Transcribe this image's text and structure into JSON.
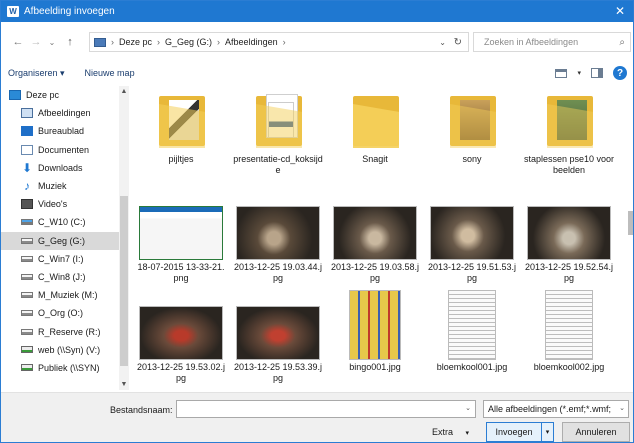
{
  "window": {
    "title": "Afbeelding invoegen",
    "app_icon": "word-icon",
    "close_glyph": "✕"
  },
  "nav_buttons": {
    "back": "←",
    "forward": "→",
    "recent": "⌄",
    "up": "↑"
  },
  "address": {
    "crumbs": [
      "Deze pc",
      "G_Geg (G:)",
      "Afbeeldingen"
    ],
    "separator": "›",
    "dropdown": "⌄",
    "refresh": "↻"
  },
  "search": {
    "placeholder": "Zoeken in Afbeeldingen",
    "icon": "⌕"
  },
  "toolbar": {
    "organize": "Organiseren ▾",
    "new_folder": "Nieuwe map",
    "dd": "▾",
    "help": "?"
  },
  "sidebar": {
    "items": [
      {
        "label": "Deze pc",
        "icon": "pc-icon"
      },
      {
        "label": "Afbeeldingen",
        "icon": "pictures-icon"
      },
      {
        "label": "Bureaublad",
        "icon": "desktop-icon"
      },
      {
        "label": "Documenten",
        "icon": "documents-icon"
      },
      {
        "label": "Downloads",
        "icon": "downloads-icon",
        "glyph": "⬇"
      },
      {
        "label": "Muziek",
        "icon": "music-icon",
        "glyph": "♪"
      },
      {
        "label": "Video's",
        "icon": "video-icon"
      },
      {
        "label": "C_W10 (C:)",
        "icon": "drive-icon"
      },
      {
        "label": "G_Geg (G:)",
        "icon": "drive-icon",
        "selected": true
      },
      {
        "label": "C_Win7 (I:)",
        "icon": "drive-icon"
      },
      {
        "label": "C_Win8 (J:)",
        "icon": "drive-icon"
      },
      {
        "label": "M_Muziek (M:)",
        "icon": "drive-icon"
      },
      {
        "label": "O_Org (O:)",
        "icon": "drive-icon"
      },
      {
        "label": "R_Reserve (R:)",
        "icon": "drive-icon"
      },
      {
        "label": "web (\\\\Syn) (V:)",
        "icon": "network-drive-icon"
      },
      {
        "label": "Publiek (\\\\SYN)",
        "icon": "network-drive-icon"
      }
    ],
    "scroll_up": "▲",
    "scroll_down": "▼"
  },
  "files": [
    {
      "name": "pijltjes",
      "kind": "folder"
    },
    {
      "name": "presentatie-cd_koksijde",
      "kind": "folder"
    },
    {
      "name": "Snagit",
      "kind": "folder"
    },
    {
      "name": "sony",
      "kind": "folder"
    },
    {
      "name": "staplessen pse10 voorbeelden",
      "kind": "folder"
    },
    {
      "name": "18-07-2015 13-33-21.png",
      "kind": "screenshot"
    },
    {
      "name": "2013-12-25 19.03.44.jpg",
      "kind": "photo"
    },
    {
      "name": "2013-12-25 19.03.58.jpg",
      "kind": "photo"
    },
    {
      "name": "2013-12-25 19.51.53.jpg",
      "kind": "photo"
    },
    {
      "name": "2013-12-25 19.52.54.jpg",
      "kind": "photo"
    },
    {
      "name": "2013-12-25 19.53.02.jpg",
      "kind": "photo"
    },
    {
      "name": "2013-12-25 19.53.39.jpg",
      "kind": "photo"
    },
    {
      "name": "bingo001.jpg",
      "kind": "bingo"
    },
    {
      "name": "bloemkool001.jpg",
      "kind": "scan"
    },
    {
      "name": "bloemkool002.jpg",
      "kind": "scan"
    }
  ],
  "bottom": {
    "filename_label": "Bestandsnaam:",
    "filename_value": "",
    "filter": "Alle afbeeldingen (*.emf;*.wmf;",
    "extra": "Extra",
    "insert": "Invoegen",
    "cancel": "Annuleren",
    "dd": "▾",
    "dd_chevron": "⌄"
  },
  "colors": {
    "accent": "#1f78d1",
    "folder": "#e8b839",
    "selected": "#d9d9d9"
  }
}
